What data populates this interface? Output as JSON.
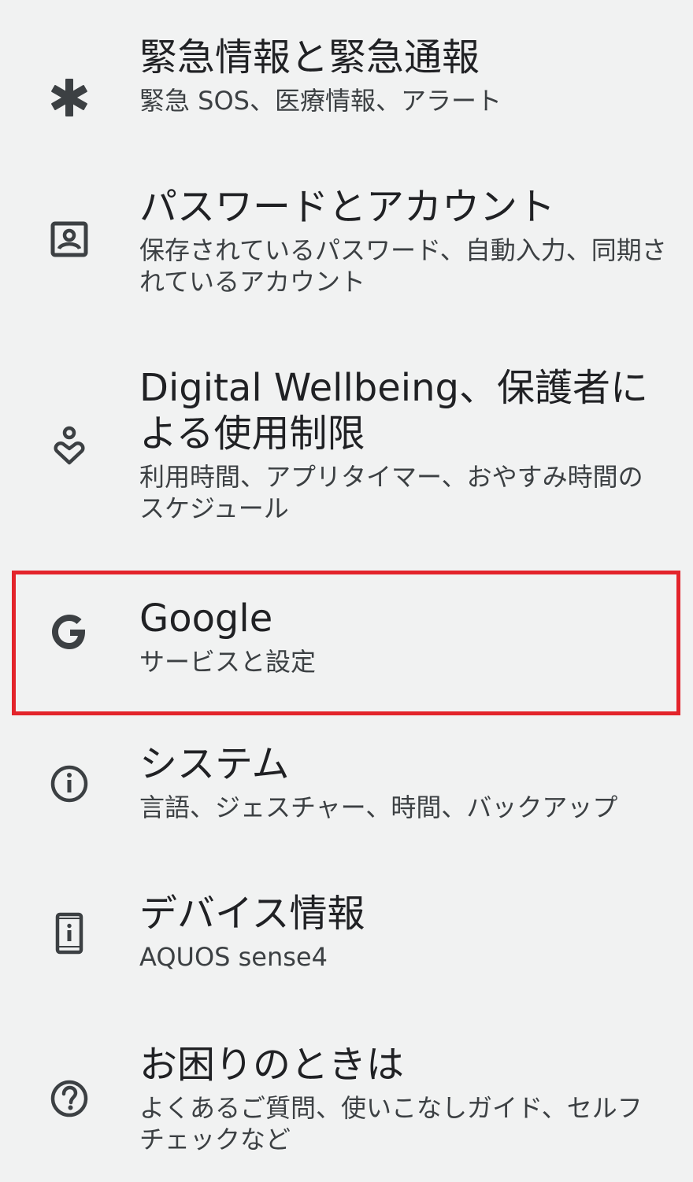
{
  "settings": {
    "items": [
      {
        "title": "緊急情報と緊急通報",
        "subtitle": "緊急 SOS、医療情報、アラート",
        "icon": "asterisk-icon"
      },
      {
        "title": "パスワードとアカウント",
        "subtitle": "保存されているパスワード、自動入力、同期されているアカウント",
        "icon": "account-box-icon"
      },
      {
        "title": "Digital Wellbeing、保護者による使用制限",
        "subtitle": "利用時間、アプリタイマー、おやすみ時間のスケジュール",
        "icon": "wellbeing-icon"
      },
      {
        "title": "Google",
        "subtitle": "サービスと設定",
        "icon": "google-g-icon"
      },
      {
        "title": "システム",
        "subtitle": "言語、ジェスチャー、時間、バックアップ",
        "icon": "info-icon"
      },
      {
        "title": "デバイス情報",
        "subtitle": "AQUOS sense4",
        "icon": "phone-info-icon"
      },
      {
        "title": "お困りのときは",
        "subtitle": "よくあるご質問、使いこなしガイド、セルフチェックなど",
        "icon": "help-icon"
      }
    ]
  },
  "colors": {
    "background": "#f1f2f2",
    "icon": "#3c4043",
    "highlight": "#e3242b"
  }
}
